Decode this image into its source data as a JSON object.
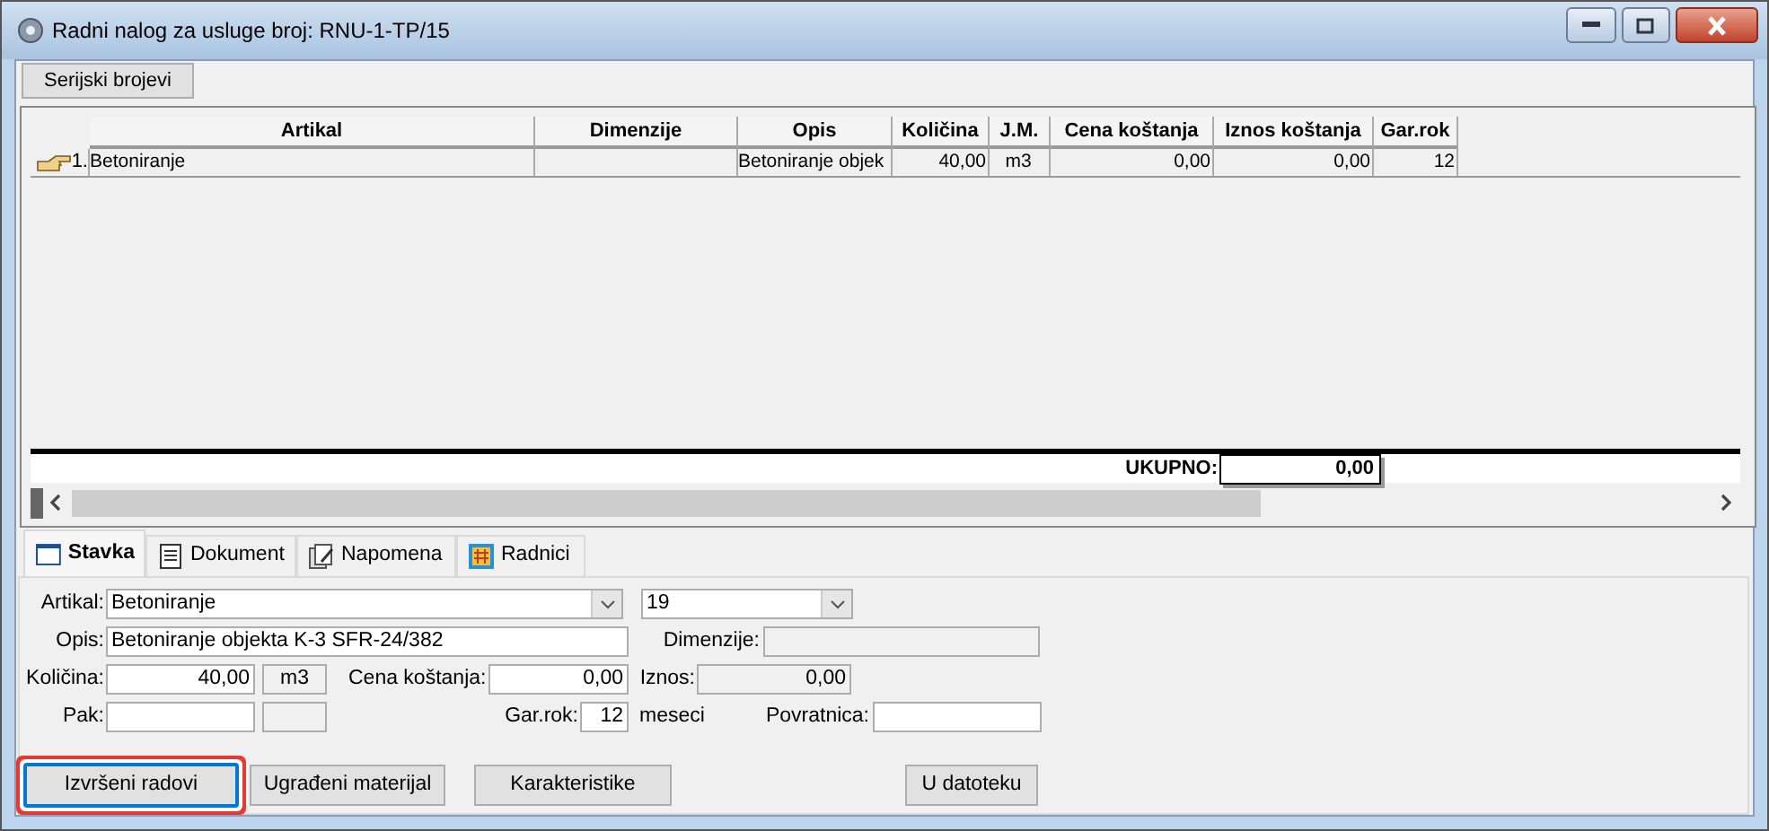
{
  "window": {
    "title": "Radni nalog za usluge broj: RNU-1-TP/15"
  },
  "toolbar": {
    "buttons": [
      "Serijski brojevi"
    ]
  },
  "grid": {
    "columns": [
      "Artikal",
      "Dimenzije",
      "Opis",
      "Količina",
      "J.M.",
      "Cena koštanja",
      "Iznos koštanja",
      "Gar.rok"
    ],
    "rows": [
      {
        "number": "1.",
        "current": true,
        "cells": [
          "Betoniranje",
          "",
          "Betoniranje objek",
          "40,00",
          "m3",
          "0,00",
          "0,00",
          "12"
        ]
      }
    ],
    "total_label": "UKUPNO:",
    "total": "0,00"
  },
  "tabs": [
    {
      "label": "Stavka",
      "selected": true
    },
    {
      "label": "Dokument",
      "selected": false
    },
    {
      "label": "Napomena",
      "selected": false
    },
    {
      "label": "Radnici",
      "selected": false
    }
  ],
  "form": [
    [
      {
        "kind": "label",
        "text": "Artikal:"
      },
      {
        "kind": "combo",
        "value": "Betoniranje"
      },
      {
        "kind": "combo",
        "value": "19"
      }
    ],
    [
      {
        "kind": "label",
        "text": "Opis:"
      },
      {
        "kind": "input",
        "value": "Betoniranje objekta K-3 SFR-24/382"
      },
      {
        "kind": "label",
        "text": "Dimenzije:"
      },
      {
        "kind": "readonly"
      }
    ],
    [
      {
        "kind": "label",
        "text": "Količina:"
      },
      {
        "kind": "number",
        "value": "40,00"
      },
      {
        "kind": "unit",
        "value": "m3"
      },
      {
        "kind": "label",
        "text": "Cena koštanja:"
      },
      {
        "kind": "number",
        "value": "0,00"
      },
      {
        "kind": "label",
        "text": "Iznos:"
      },
      {
        "kind": "readonly",
        "value": "0,00"
      }
    ],
    [
      {
        "kind": "label",
        "text": "Pak:"
      },
      {
        "kind": "input"
      },
      {
        "kind": "unit"
      },
      {
        "kind": "label",
        "text": "Gar.rok:"
      },
      {
        "kind": "number",
        "value": "12"
      },
      {
        "kind": "suffix",
        "text": "meseci"
      },
      {
        "kind": "label",
        "text": "Povratnica:"
      },
      {
        "kind": "input"
      }
    ]
  ],
  "buttons": [
    {
      "label": "Izvršeni radovi",
      "highlighted": true
    },
    {
      "label": "Ugrađeni materijal",
      "highlighted": false
    },
    {
      "label": "Karakteristike",
      "highlighted": false
    },
    {
      "label": "U datoteku",
      "highlighted": false
    }
  ]
}
